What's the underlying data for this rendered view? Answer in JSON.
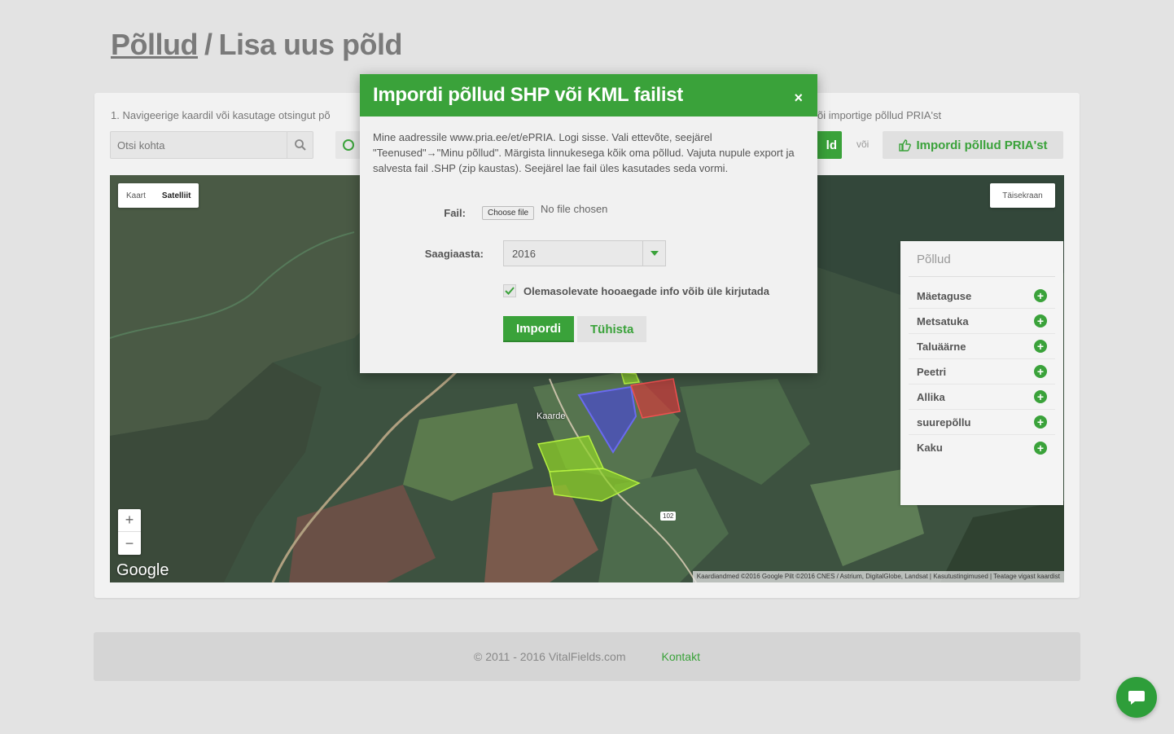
{
  "page": {
    "breadcrumb_parent": "Põllud",
    "breadcrumb_separator": "/",
    "breadcrumb_current": "Lisa uus põld"
  },
  "toolbar": {
    "instruction_left": "1. Navigeerige kaardil või kasutage otsingut põ",
    "instruction_right": "õi importige põllud PRIA'st",
    "search_placeholder": "Otsi kohta",
    "add_field_partial": "ld",
    "or_text": "või",
    "pria_button": "Impordi põllud PRIA'st"
  },
  "map": {
    "type_map": "Kaart",
    "type_satellite": "Satelliit",
    "fullscreen": "Täisekraan",
    "zoom_in": "+",
    "zoom_out": "−",
    "logo": "Google",
    "attribution": "Kaardiandmed ©2016 Google Pilt ©2016 CNES / Astrium, DigitalGlobe, Landsat | Kasutustingimused | Teatage vigast kaardist",
    "road_label": "102",
    "place_label": "Kaarde"
  },
  "fields_panel": {
    "title": "Põllud",
    "items": [
      {
        "name": "Mäetaguse"
      },
      {
        "name": "Metsatuka"
      },
      {
        "name": "Taluäärne"
      },
      {
        "name": "Peetri"
      },
      {
        "name": "Allika"
      },
      {
        "name": "suurepõllu"
      },
      {
        "name": "Kaku"
      }
    ]
  },
  "modal": {
    "title": "Impordi põllud SHP või KML failist",
    "close": "×",
    "description": "Mine aadressile www.pria.ee/et/ePRIA. Logi sisse. Vali ettevõte, seejärel \"Teenused\"→\"Minu põllud\". Märgista linnukesega kõik oma põllud. Vajuta nupule export ja salvesta fail .SHP (zip kaustas). Seejärel lae fail üles kasutades seda vormi.",
    "file_label": "Fail:",
    "file_button": "Choose file",
    "file_status": "No file chosen",
    "year_label": "Saagiaasta:",
    "year_value": "2016",
    "overwrite_label": "Olemasolevate hooaegade info võib üle kirjutada",
    "overwrite_checked": true,
    "import_button": "Impordi",
    "cancel_button": "Tühista"
  },
  "footer": {
    "copyright": "© 2011 - 2016 VitalFields.com",
    "contact": "Kontakt"
  },
  "colors": {
    "accent": "#3aa23a",
    "field_green": "#8ed02a",
    "field_blue": "#4b4cc8",
    "field_red": "#d23c3c"
  }
}
